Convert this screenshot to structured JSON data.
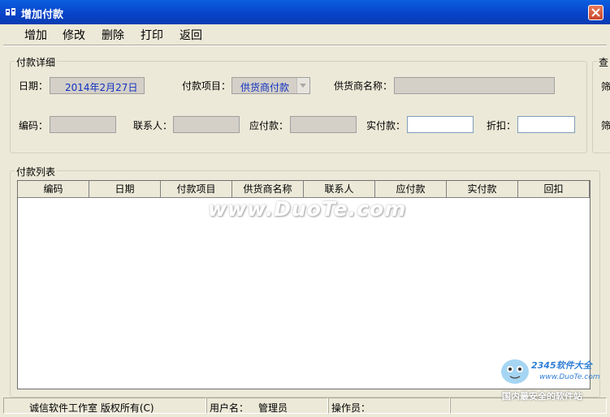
{
  "window": {
    "title": "增加付款"
  },
  "menu": [
    "增加",
    "修改",
    "删除",
    "打印",
    "返回"
  ],
  "detail": {
    "legend": "付款详细",
    "date_label": "日期：",
    "date_value": "2014年2月27日",
    "item_label": "付款项目：",
    "item_value": "供货商付款",
    "supplier_label": "供货商名称：",
    "code_label": "编码：",
    "contact_label": "联系人：",
    "payable_label": "应付款：",
    "actual_label": "实付款：",
    "discount_label": "折扣："
  },
  "query": {
    "legend": "查",
    "row1": "筛",
    "row2": "筛"
  },
  "list": {
    "legend": "付款列表",
    "columns": [
      "编码",
      "日期",
      "付款项目",
      "供货商名称",
      "联系人",
      "应付款",
      "实付款",
      "回扣"
    ]
  },
  "status": {
    "copyright": "诚信软件工作室 版权所有(C)",
    "user_label": "用户名：",
    "user_value": "管理员",
    "operator_label": "操作员："
  },
  "overlay": {
    "watermark": "www.DuoTe.com",
    "brand": "2345软件大全",
    "site": "www.DuoTe.com",
    "slogan": "国内最安全的软件站"
  }
}
